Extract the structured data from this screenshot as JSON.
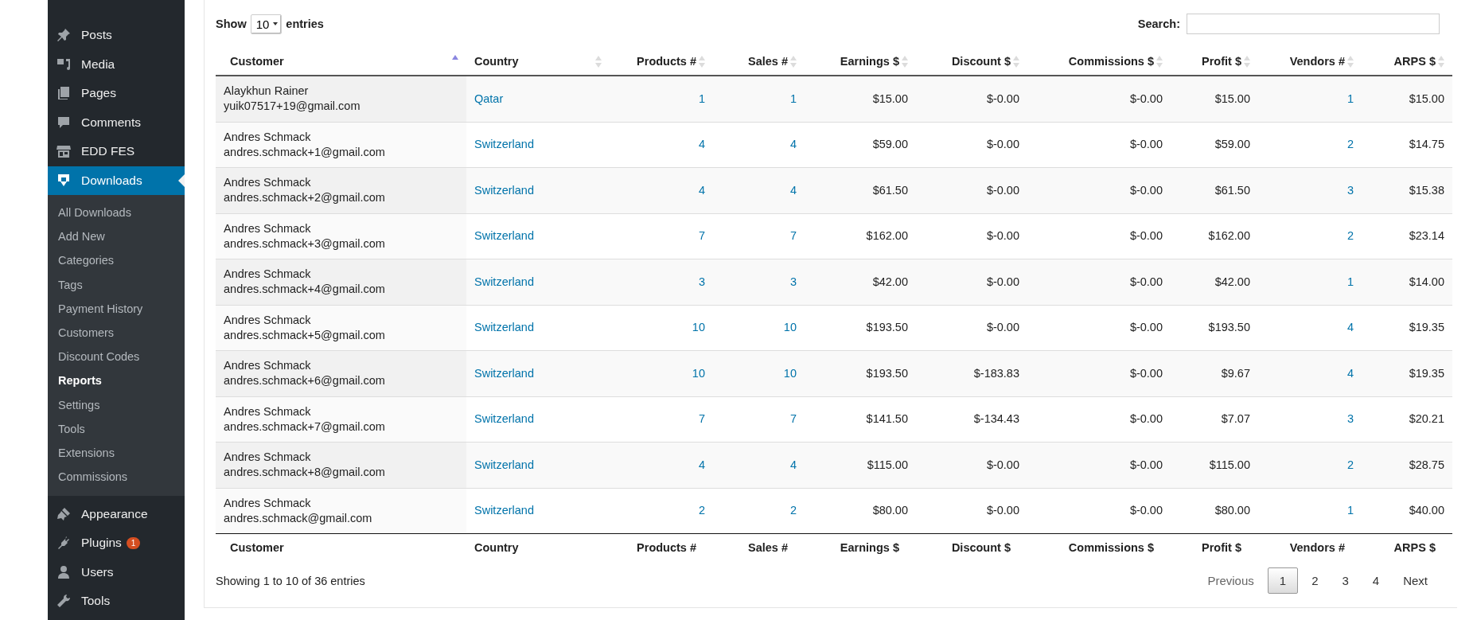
{
  "sidebar": {
    "menu": [
      {
        "label": "Posts",
        "selected": false
      },
      {
        "label": "Media",
        "selected": false
      },
      {
        "label": "Pages",
        "selected": false
      },
      {
        "label": "Comments",
        "selected": false
      },
      {
        "label": "EDD FES",
        "selected": false
      },
      {
        "label": "Downloads",
        "selected": true,
        "submenu": [
          {
            "label": "All Downloads",
            "selected": false
          },
          {
            "label": "Add New",
            "selected": false
          },
          {
            "label": "Categories",
            "selected": false
          },
          {
            "label": "Tags",
            "selected": false
          },
          {
            "label": "Payment History",
            "selected": false
          },
          {
            "label": "Customers",
            "selected": false
          },
          {
            "label": "Discount Codes",
            "selected": false
          },
          {
            "label": "Reports",
            "selected": true
          },
          {
            "label": "Settings",
            "selected": false
          },
          {
            "label": "Tools",
            "selected": false
          },
          {
            "label": "Extensions",
            "selected": false
          },
          {
            "label": "Commissions",
            "selected": false
          }
        ]
      },
      {
        "label": "Appearance",
        "selected": false
      },
      {
        "label": "Plugins",
        "selected": false,
        "badge": "1"
      },
      {
        "label": "Users",
        "selected": false
      },
      {
        "label": "Tools",
        "selected": false
      }
    ]
  },
  "length_control": {
    "before": "Show",
    "value": "10",
    "after": "entries"
  },
  "search": {
    "label": "Search:"
  },
  "table": {
    "columns": [
      {
        "label": "Customer",
        "sorted": true,
        "kind": "person"
      },
      {
        "label": "Country",
        "sorted": false,
        "kind": "link"
      },
      {
        "label": "Products #",
        "sorted": false,
        "kind": "link"
      },
      {
        "label": "Sales #",
        "sorted": false,
        "kind": "link"
      },
      {
        "label": "Earnings $",
        "sorted": false,
        "kind": "text"
      },
      {
        "label": "Discount $",
        "sorted": false,
        "kind": "text"
      },
      {
        "label": "Commissions $",
        "sorted": false,
        "kind": "text"
      },
      {
        "label": "Profit $",
        "sorted": false,
        "kind": "text"
      },
      {
        "label": "Vendors #",
        "sorted": false,
        "kind": "link"
      },
      {
        "label": "ARPS $",
        "sorted": false,
        "kind": "text"
      }
    ],
    "rows": [
      {
        "cells": [
          {
            "name": "Alaykhun Rainer",
            "email": "yuik07517+19@gmail.com"
          },
          "Qatar",
          "1",
          "1",
          "$15.00",
          "$-0.00",
          "$-0.00",
          "$15.00",
          "1",
          "$15.00"
        ]
      },
      {
        "cells": [
          {
            "name": "Andres Schmack",
            "email": "andres.schmack+1@gmail.com"
          },
          "Switzerland",
          "4",
          "4",
          "$59.00",
          "$-0.00",
          "$-0.00",
          "$59.00",
          "2",
          "$14.75"
        ]
      },
      {
        "cells": [
          {
            "name": "Andres Schmack",
            "email": "andres.schmack+2@gmail.com"
          },
          "Switzerland",
          "4",
          "4",
          "$61.50",
          "$-0.00",
          "$-0.00",
          "$61.50",
          "3",
          "$15.38"
        ]
      },
      {
        "cells": [
          {
            "name": "Andres Schmack",
            "email": "andres.schmack+3@gmail.com"
          },
          "Switzerland",
          "7",
          "7",
          "$162.00",
          "$-0.00",
          "$-0.00",
          "$162.00",
          "2",
          "$23.14"
        ]
      },
      {
        "cells": [
          {
            "name": "Andres Schmack",
            "email": "andres.schmack+4@gmail.com"
          },
          "Switzerland",
          "3",
          "3",
          "$42.00",
          "$-0.00",
          "$-0.00",
          "$42.00",
          "1",
          "$14.00"
        ]
      },
      {
        "cells": [
          {
            "name": "Andres Schmack",
            "email": "andres.schmack+5@gmail.com"
          },
          "Switzerland",
          "10",
          "10",
          "$193.50",
          "$-0.00",
          "$-0.00",
          "$193.50",
          "4",
          "$19.35"
        ]
      },
      {
        "cells": [
          {
            "name": "Andres Schmack",
            "email": "andres.schmack+6@gmail.com"
          },
          "Switzerland",
          "10",
          "10",
          "$193.50",
          "$-183.83",
          "$-0.00",
          "$9.67",
          "4",
          "$19.35"
        ]
      },
      {
        "cells": [
          {
            "name": "Andres Schmack",
            "email": "andres.schmack+7@gmail.com"
          },
          "Switzerland",
          "7",
          "7",
          "$141.50",
          "$-134.43",
          "$-0.00",
          "$7.07",
          "3",
          "$20.21"
        ]
      },
      {
        "cells": [
          {
            "name": "Andres Schmack",
            "email": "andres.schmack+8@gmail.com"
          },
          "Switzerland",
          "4",
          "4",
          "$115.00",
          "$-0.00",
          "$-0.00",
          "$115.00",
          "2",
          "$28.75"
        ]
      },
      {
        "cells": [
          {
            "name": "Andres Schmack",
            "email": "andres.schmack@gmail.com"
          },
          "Switzerland",
          "2",
          "2",
          "$80.00",
          "$-0.00",
          "$-0.00",
          "$80.00",
          "1",
          "$40.00"
        ]
      }
    ],
    "footer": [
      "Customer",
      "Country",
      "Products #",
      "Sales #",
      "Earnings $",
      "Discount $",
      "Commissions $",
      "Profit $",
      "Vendors #",
      "ARPS $"
    ]
  },
  "info": "Showing 1 to 10 of 36 entries",
  "pagination": {
    "previous": {
      "label": "Previous",
      "disabled": true
    },
    "pages": [
      {
        "label": "1",
        "selected": true
      },
      {
        "label": "2",
        "selected": false
      },
      {
        "label": "3",
        "selected": false
      },
      {
        "label": "4",
        "selected": false
      }
    ],
    "next": {
      "label": "Next",
      "disabled": false
    }
  }
}
